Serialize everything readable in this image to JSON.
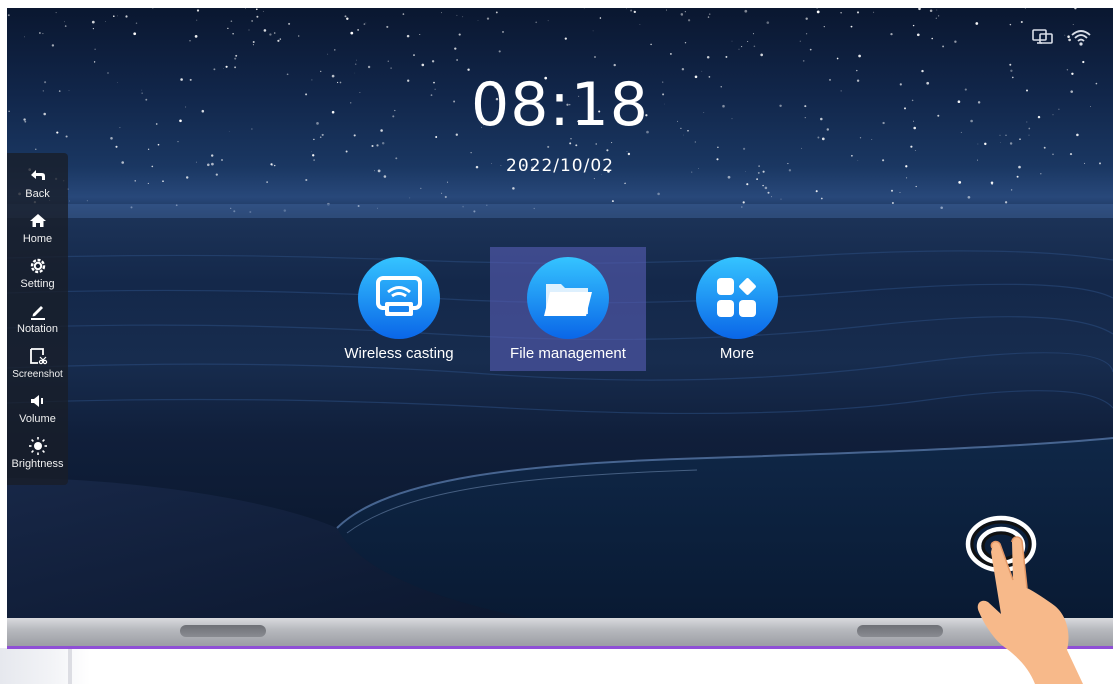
{
  "clock": {
    "time": "08:18",
    "date": "2022/10/02"
  },
  "status_bar": {
    "icons": [
      "screen-cast-icon",
      "wifi-icon"
    ]
  },
  "sidebar": {
    "items": [
      {
        "label": "Back",
        "icon": "back-arrow-icon"
      },
      {
        "label": "Home",
        "icon": "home-icon"
      },
      {
        "label": "Setting",
        "icon": "gear-icon"
      },
      {
        "label": "Notation",
        "icon": "pen-icon"
      },
      {
        "label": "Screenshot",
        "icon": "screenshot-icon"
      },
      {
        "label": "Volume",
        "icon": "speaker-icon"
      },
      {
        "label": "Brightness",
        "icon": "sun-icon"
      }
    ]
  },
  "apps": [
    {
      "label": "Wireless casting",
      "icon": "wireless-casting-icon",
      "selected": false
    },
    {
      "label": "File management",
      "icon": "folder-icon",
      "selected": true
    },
    {
      "label": "More",
      "icon": "apps-grid-icon",
      "selected": false
    }
  ],
  "colors": {
    "app_tile_top": "#35c4ff",
    "app_tile_bottom": "#0a66e8",
    "selection": "#565cb2",
    "bezel_accent": "#8f4fd6"
  },
  "illustration": {
    "icon": "touch-hand-icon"
  }
}
